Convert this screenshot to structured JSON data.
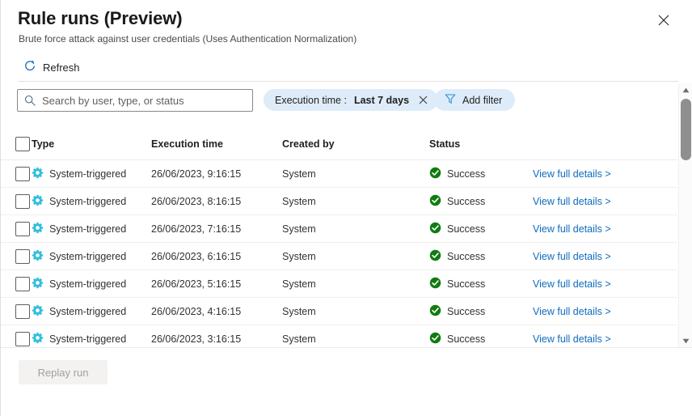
{
  "header": {
    "title": "Rule runs (Preview)",
    "subtitle": "Brute force attack against user credentials (Uses Authentication Normalization)",
    "close_label": "Close",
    "refresh_label": "Refresh"
  },
  "search": {
    "placeholder": "Search by user, type, or status",
    "value": ""
  },
  "filters": {
    "pill": {
      "label": "Execution time :",
      "value": "Last 7 days"
    },
    "add_filter_label": "Add filter"
  },
  "table": {
    "columns": [
      {
        "key": "check",
        "label": ""
      },
      {
        "key": "type",
        "label": "Type"
      },
      {
        "key": "time",
        "label": "Execution time"
      },
      {
        "key": "by",
        "label": "Created by"
      },
      {
        "key": "status",
        "label": "Status"
      },
      {
        "key": "link",
        "label": ""
      }
    ],
    "rows": [
      {
        "type": "System-triggered",
        "time": "26/06/2023, 9:16:15",
        "created_by": "System",
        "status": "Success",
        "link": "View full details >"
      },
      {
        "type": "System-triggered",
        "time": "26/06/2023, 8:16:15",
        "created_by": "System",
        "status": "Success",
        "link": "View full details >"
      },
      {
        "type": "System-triggered",
        "time": "26/06/2023, 7:16:15",
        "created_by": "System",
        "status": "Success",
        "link": "View full details >"
      },
      {
        "type": "System-triggered",
        "time": "26/06/2023, 6:16:15",
        "created_by": "System",
        "status": "Success",
        "link": "View full details >"
      },
      {
        "type": "System-triggered",
        "time": "26/06/2023, 5:16:15",
        "created_by": "System",
        "status": "Success",
        "link": "View full details >"
      },
      {
        "type": "System-triggered",
        "time": "26/06/2023, 4:16:15",
        "created_by": "System",
        "status": "Success",
        "link": "View full details >"
      },
      {
        "type": "System-triggered",
        "time": "26/06/2023, 3:16:15",
        "created_by": "System",
        "status": "Success",
        "link": "View full details >"
      }
    ]
  },
  "footer": {
    "replay_label": "Replay run"
  },
  "colors": {
    "accent_link": "#0f6cbd",
    "pill_background": "#deecf9",
    "gear_icon": "#32bedd",
    "success_icon": "#107c10",
    "refresh_icon": "#0f6cbd"
  }
}
